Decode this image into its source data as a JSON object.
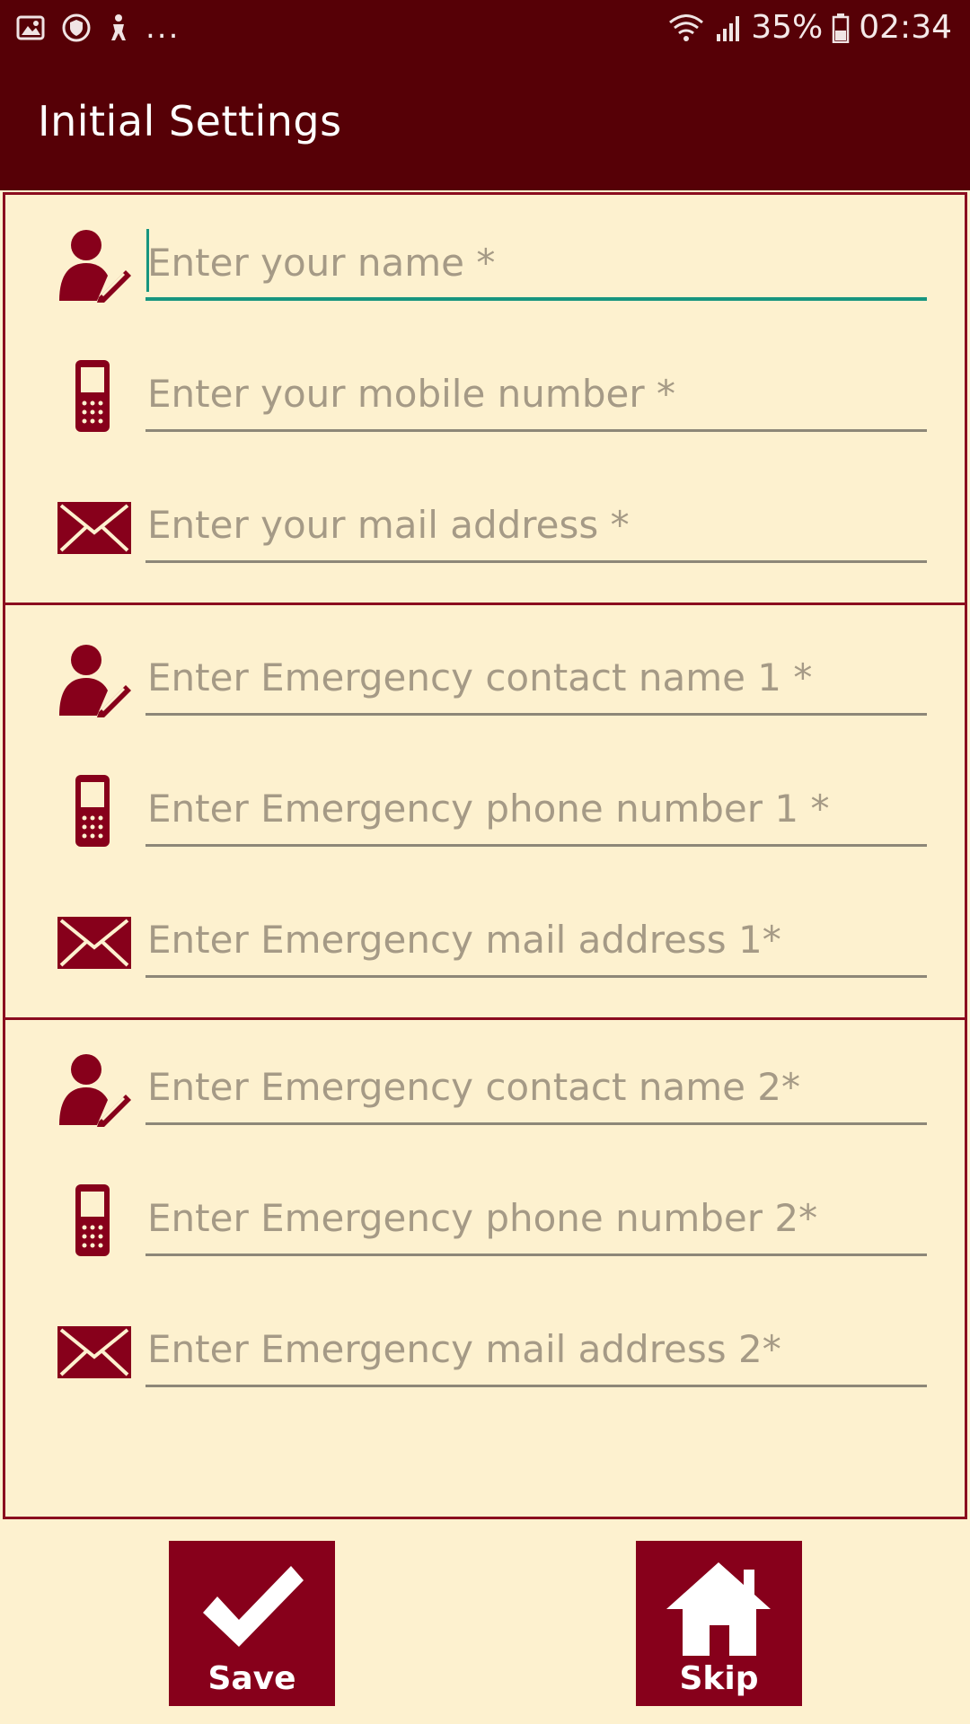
{
  "status_bar": {
    "overflow": "...",
    "battery_percent": "35%",
    "time": "02:34"
  },
  "app_bar": {
    "title": "Initial Settings"
  },
  "sections": [
    {
      "fields": [
        {
          "icon": "user-edit-icon",
          "placeholder": "Enter your name *"
        },
        {
          "icon": "mobile-phone-icon",
          "placeholder": "Enter your mobile number *"
        },
        {
          "icon": "mail-icon",
          "placeholder": "Enter your mail address *"
        }
      ]
    },
    {
      "fields": [
        {
          "icon": "user-edit-icon",
          "placeholder": "Enter Emergency contact name 1 *"
        },
        {
          "icon": "mobile-phone-icon",
          "placeholder": "Enter Emergency phone number 1 *"
        },
        {
          "icon": "mail-icon",
          "placeholder": "Enter Emergency mail address 1*"
        }
      ]
    },
    {
      "fields": [
        {
          "icon": "user-edit-icon",
          "placeholder": "Enter Emergency contact name 2*"
        },
        {
          "icon": "mobile-phone-icon",
          "placeholder": "Enter Emergency phone number 2*"
        },
        {
          "icon": "mail-icon",
          "placeholder": "Enter Emergency mail address 2*"
        }
      ]
    }
  ],
  "buttons": {
    "save_label": "Save",
    "skip_label": "Skip"
  },
  "colors": {
    "primary_dark": "#560006",
    "accent": "#87001b",
    "background": "#fdf1cf",
    "focus": "#17957f"
  }
}
